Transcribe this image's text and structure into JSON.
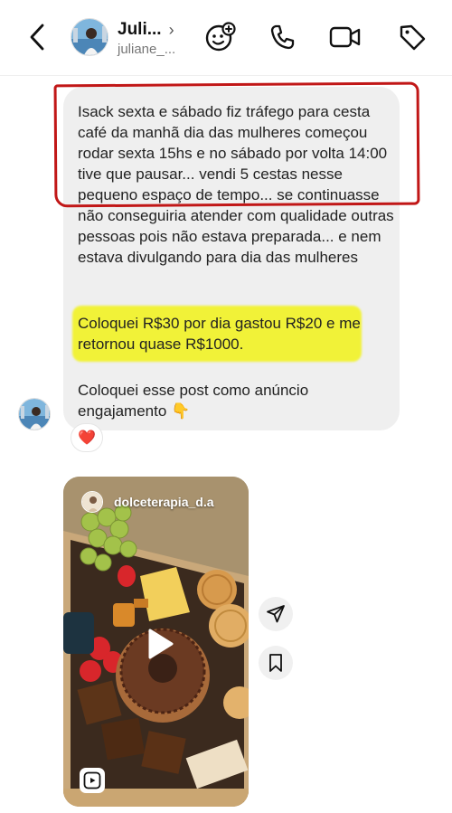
{
  "header": {
    "name": "Juli...",
    "username": "juliane_...",
    "icons": [
      "back-chevron-icon",
      "effects-icon",
      "phone-icon",
      "video-icon",
      "tag-icon"
    ]
  },
  "message": {
    "paragraph1": "Isack sexta e sábado fiz tráfego para cesta café da manhã dia das mulheres começou rodar sexta 15hs e no sábado por volta 14:00 tive que pausar... vendi 5 cestas nesse pequeno espaço de tempo... se continuasse não conseguiria atender com qualidade outras pessoas pois não estava preparada... e nem estava divulgando para dia das mulheres",
    "paragraph2": "Coloquei R$30 por dia gastou R$20 e me retornou quase R$1000.",
    "paragraph3": "Coloquei esse post como anúncio engajamento 👇",
    "reaction": "❤️"
  },
  "reel": {
    "username": "dolceterapia_d.a"
  },
  "colors": {
    "highlight": "#f1f238",
    "annotation_red": "#c11717",
    "bubble": "#efefef"
  }
}
